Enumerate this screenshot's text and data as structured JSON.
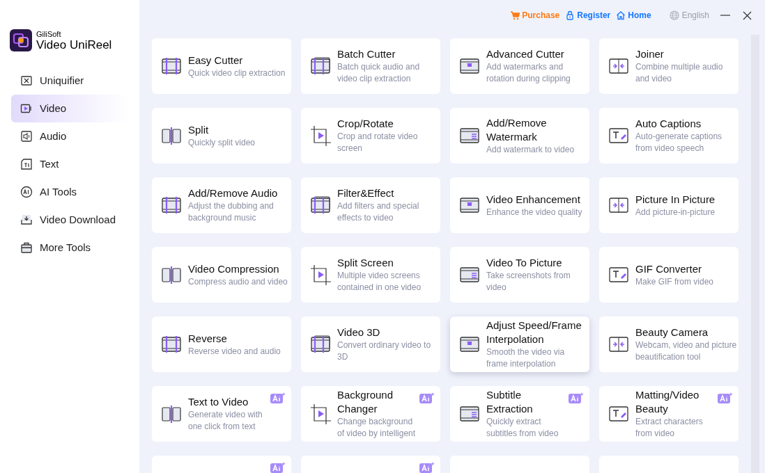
{
  "app": {
    "brand": "GiliSoft",
    "name": "Video UniReel"
  },
  "top_links": [
    {
      "kind": "purchase",
      "label": "Purchase"
    },
    {
      "kind": "register",
      "label": "Register"
    },
    {
      "kind": "home",
      "label": "Home"
    }
  ],
  "language": "English",
  "sidebar": {
    "items": [
      {
        "label": "Uniquifier",
        "selected": false
      },
      {
        "label": "Video",
        "selected": true
      },
      {
        "label": "Audio",
        "selected": false
      },
      {
        "label": "Text",
        "selected": false
      },
      {
        "label": "AI Tools",
        "selected": false
      },
      {
        "label": "Video Download",
        "selected": false
      },
      {
        "label": "More Tools",
        "selected": false
      }
    ]
  },
  "tools": [
    {
      "title": "Easy Cutter",
      "description": "Quick video clip extraction",
      "ai": false,
      "hovered": false
    },
    {
      "title": "Batch Cutter",
      "description": "Batch quick audio and video clip extraction",
      "ai": false,
      "hovered": false
    },
    {
      "title": "Advanced Cutter",
      "description": "Add watermarks and rotation during clipping",
      "ai": false,
      "hovered": false
    },
    {
      "title": "Joiner",
      "description": "Combine multiple audio and video",
      "ai": false,
      "hovered": false
    },
    {
      "title": "Split",
      "description": "Quickly split video",
      "ai": false,
      "hovered": false
    },
    {
      "title": "Crop/Rotate",
      "description": "Crop and rotate video screen",
      "ai": false,
      "hovered": false
    },
    {
      "title": "Add/Remove Watermark",
      "description": "Add watermark to video",
      "ai": false,
      "hovered": false
    },
    {
      "title": "Auto Captions",
      "description": "Auto-generate captions from video speech",
      "ai": false,
      "hovered": false
    },
    {
      "title": "Add/Remove Audio",
      "description": "Adjust the dubbing and background music",
      "ai": false,
      "hovered": false
    },
    {
      "title": "Filter&Effect",
      "description": "Add filters and special effects to video",
      "ai": false,
      "hovered": false
    },
    {
      "title": "Video Enhancement",
      "description": "Enhance the video quality",
      "ai": false,
      "hovered": false
    },
    {
      "title": "Picture In Picture",
      "description": "Add picture-in-picture",
      "ai": false,
      "hovered": false
    },
    {
      "title": "Video Compression",
      "description": "Compress audio and video",
      "ai": false,
      "hovered": false
    },
    {
      "title": "Split Screen",
      "description": "Multiple video screens contained in one video",
      "ai": false,
      "hovered": false
    },
    {
      "title": "Video To Picture",
      "description": "Take screenshots from video",
      "ai": false,
      "hovered": false
    },
    {
      "title": "GIF Converter",
      "description": "Make GIF from video",
      "ai": false,
      "hovered": false
    },
    {
      "title": "Reverse",
      "description": "Reverse video and audio",
      "ai": false,
      "hovered": false
    },
    {
      "title": "Video 3D",
      "description": "Convert ordinary video to 3D",
      "ai": false,
      "hovered": false
    },
    {
      "title": "Adjust Speed/Frame Interpolation",
      "description": "Smooth the video via frame interpolation",
      "ai": false,
      "hovered": true
    },
    {
      "title": "Beauty Camera",
      "description": "Webcam, video and picture beautification tool",
      "ai": false,
      "hovered": false
    },
    {
      "title": "Text to Video",
      "description": "Generate video with one click from text",
      "ai": true,
      "hovered": false
    },
    {
      "title": "Background Changer",
      "description": "Change background of video by intelligent",
      "ai": true,
      "hovered": false
    },
    {
      "title": "Subtitle Extraction",
      "description": "Quickly extract subtitles from video",
      "ai": true,
      "hovered": false
    },
    {
      "title": "Matting/Video Beauty",
      "description": "Extract characters from video",
      "ai": true,
      "hovered": false
    },
    {
      "ai": true,
      "hovered": false
    },
    {
      "ai": true,
      "hovered": false
    },
    {
      "ai": false,
      "hovered": false
    },
    {
      "ai": false,
      "hovered": false
    }
  ]
}
